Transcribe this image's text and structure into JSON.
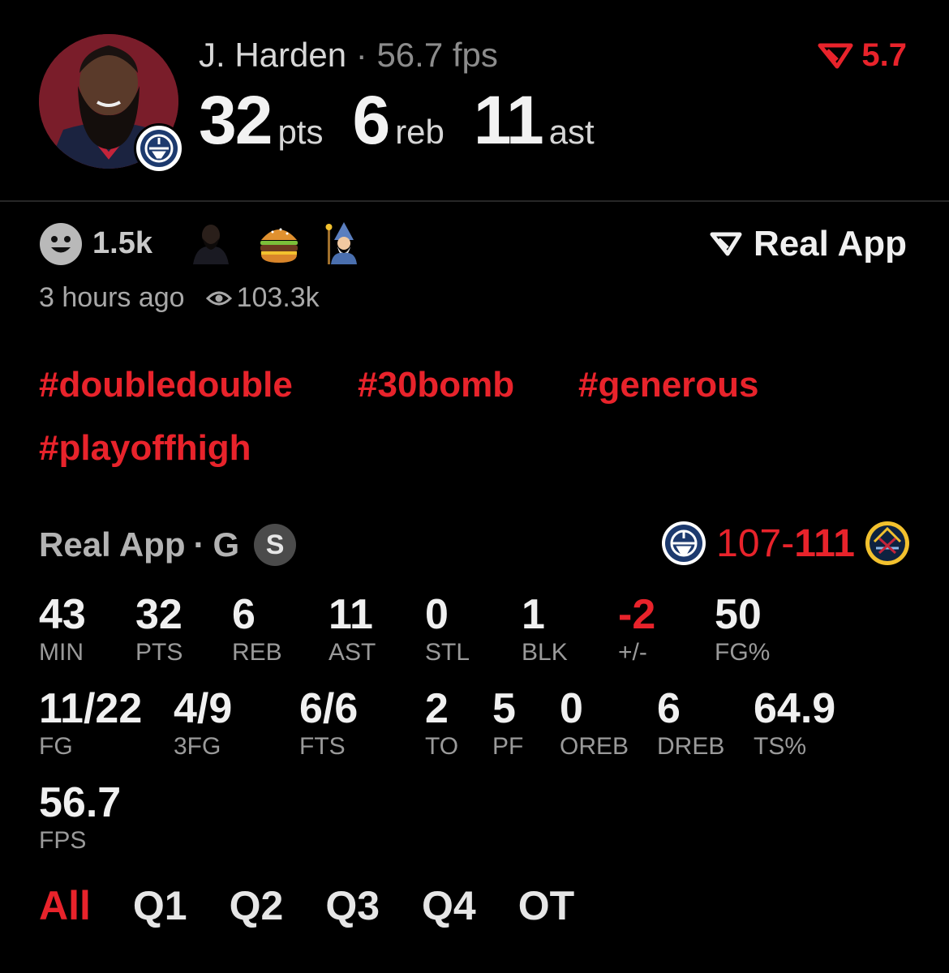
{
  "header": {
    "player_name": "J. Harden",
    "separator": "·",
    "fps_text": "56.7 fps",
    "big_stats": [
      {
        "value": "32",
        "label": "pts"
      },
      {
        "value": "6",
        "label": "reb"
      },
      {
        "value": "11",
        "label": "ast"
      }
    ],
    "score_badge": "5.7"
  },
  "reactions": {
    "count": "1.5k",
    "emojis": [
      "person-avatar-emoji",
      "hamburger-emoji",
      "wizard-emoji"
    ],
    "brand": "Real App"
  },
  "meta": {
    "time": "3 hours ago",
    "views": "103.3k"
  },
  "hashtags": [
    "#doubledouble",
    "#30bomb",
    "#generous",
    "#playoffhigh"
  ],
  "game": {
    "league": "Real App",
    "separator": "·",
    "position": "G",
    "badge": "S",
    "score_home": "107",
    "score_dash": "-",
    "score_away": "111"
  },
  "stats_row1": [
    {
      "value": "43",
      "label": "MIN"
    },
    {
      "value": "32",
      "label": "PTS"
    },
    {
      "value": "6",
      "label": "REB"
    },
    {
      "value": "11",
      "label": "AST"
    },
    {
      "value": "0",
      "label": "STL"
    },
    {
      "value": "1",
      "label": "BLK"
    },
    {
      "value": "-2",
      "label": "+/-"
    },
    {
      "value": "50",
      "label": "FG%"
    }
  ],
  "stats_row2": [
    {
      "value": "11/22",
      "label": "FG"
    },
    {
      "value": "4/9",
      "label": "3FG"
    },
    {
      "value": "6/6",
      "label": "FTS"
    },
    {
      "value": "2",
      "label": "TO"
    },
    {
      "value": "5",
      "label": "PF"
    },
    {
      "value": "0",
      "label": "OREB"
    },
    {
      "value": "6",
      "label": "DREB"
    },
    {
      "value": "64.9",
      "label": "TS%"
    }
  ],
  "stats_row3": [
    {
      "value": "56.7",
      "label": "FPS"
    }
  ],
  "tabs": [
    "All",
    "Q1",
    "Q2",
    "Q3",
    "Q4",
    "OT"
  ],
  "colors": {
    "accent": "#e8232b",
    "background": "#000000",
    "muted": "#9a9a9a"
  }
}
